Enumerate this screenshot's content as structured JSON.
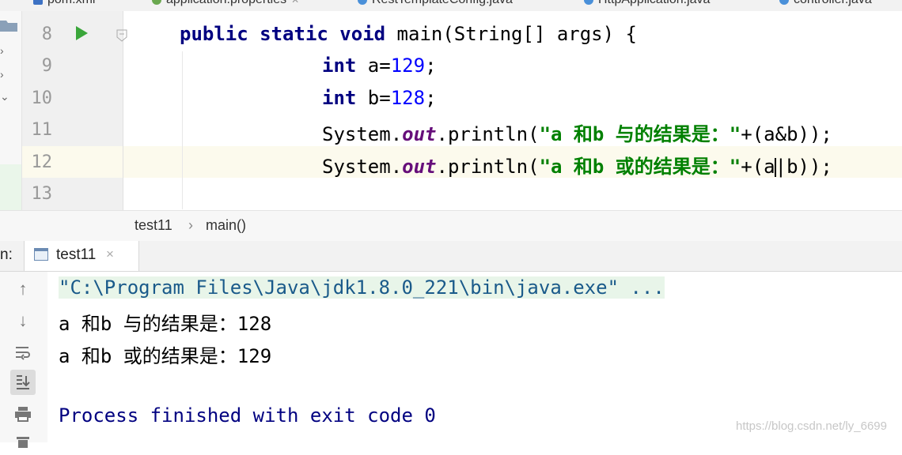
{
  "editor_tabs": [
    {
      "label": "pom.xml",
      "icon": "maven-xml-icon"
    },
    {
      "label": "application.properties",
      "icon": "properties-icon"
    },
    {
      "label": "RestTemplateConfig.java",
      "icon": "java-class-icon"
    },
    {
      "label": "HttpApplication.java",
      "icon": "java-class-icon"
    },
    {
      "label": "controller.java",
      "icon": "java-class-icon"
    }
  ],
  "code": {
    "lines": [
      {
        "number": "8",
        "parts": [
          {
            "t": "public static void ",
            "c": "kw"
          },
          {
            "t": "main(String[] args) {",
            "c": ""
          }
        ]
      },
      {
        "number": "9",
        "parts": [
          {
            "t": "int ",
            "c": "kw"
          },
          {
            "t": "a=",
            "c": ""
          },
          {
            "t": "129",
            "c": "num"
          },
          {
            "t": ";",
            "c": ""
          }
        ]
      },
      {
        "number": "10",
        "parts": [
          {
            "t": "int ",
            "c": "kw"
          },
          {
            "t": "b=",
            "c": ""
          },
          {
            "t": "128",
            "c": "num"
          },
          {
            "t": ";",
            "c": ""
          }
        ]
      },
      {
        "number": "11",
        "parts": [
          {
            "t": "System.",
            "c": ""
          },
          {
            "t": "out",
            "c": "fld"
          },
          {
            "t": ".println(",
            "c": ""
          },
          {
            "t": "\"a 和b 与的结果是：\"",
            "c": "str"
          },
          {
            "t": "+(a&b));",
            "c": ""
          }
        ]
      },
      {
        "number": "12",
        "parts": [
          {
            "t": "System.",
            "c": ""
          },
          {
            "t": "out",
            "c": "fld"
          },
          {
            "t": ".println(",
            "c": ""
          },
          {
            "t": "\"a 和b 或的结果是：\"",
            "c": "str"
          },
          {
            "t": "+(a",
            "c": ""
          },
          {
            "t": "|b));",
            "c": "",
            "caret": true
          }
        ]
      },
      {
        "number": "13",
        "parts": []
      }
    ]
  },
  "breadcrumb": {
    "class_name": "test11",
    "separator": "›",
    "method_name": "main()"
  },
  "run_window": {
    "label": "n:",
    "tab_label": "test11",
    "tab_close": "×"
  },
  "console": {
    "command": "\"C:\\Program Files\\Java\\jdk1.8.0_221\\bin\\java.exe\" ...",
    "output_lines": [
      "a 和b 与的结果是：128",
      "a 和b 或的结果是：129"
    ],
    "exit_message": "Process finished with exit code 0"
  },
  "console_toolbar": [
    "up-arrow-icon",
    "down-arrow-icon",
    "soft-wrap-icon",
    "scroll-to-end-icon",
    "print-icon",
    "trash-icon"
  ],
  "watermark": "https://blog.csdn.net/ly_6699",
  "colors": {
    "keyword": "#000080",
    "number": "#0000ff",
    "string": "#008000",
    "static_field": "#660e7a",
    "run_icon": "#3aa63a",
    "current_line": "#fcfaed",
    "command_line_bg": "#e8f5e9"
  }
}
